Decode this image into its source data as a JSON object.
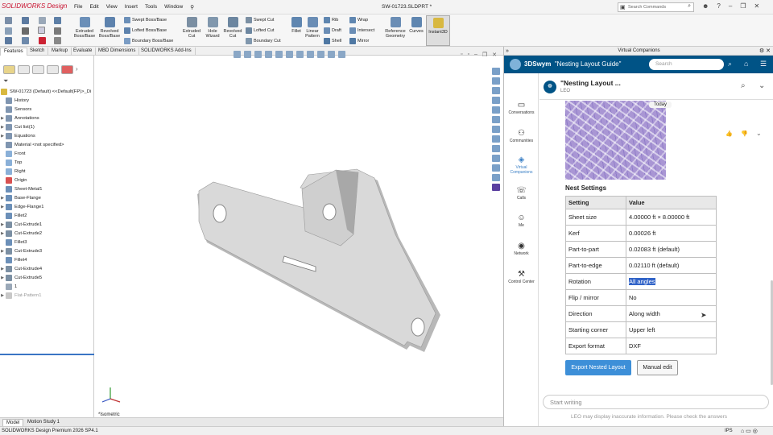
{
  "app": {
    "logo": "SOLIDWORKS Design",
    "menu": [
      "File",
      "Edit",
      "View",
      "Insert",
      "Tools",
      "Window"
    ],
    "file_title": "SW-01723.SLDPRT *",
    "search_placeholder": "Search Commands"
  },
  "ribbon": {
    "big": [
      {
        "label": "Extruded\nBoss/Base",
        "icon": "extruded-boss-icon"
      },
      {
        "label": "Revolved\nBoss/Base",
        "icon": "revolved-boss-icon"
      },
      {
        "label": "Extruded\nCut",
        "icon": "extruded-cut-icon"
      },
      {
        "label": "Hole\nWizard",
        "icon": "hole-wizard-icon"
      },
      {
        "label": "Revolved\nCut",
        "icon": "revolved-cut-icon"
      },
      {
        "label": "Fillet",
        "icon": "fillet-icon"
      },
      {
        "label": "Linear\nPattern",
        "icon": "linear-pattern-icon"
      },
      {
        "label": "Reference\nGeometry",
        "icon": "reference-geometry-icon"
      },
      {
        "label": "Curves",
        "icon": "curves-icon"
      },
      {
        "label": "Instant3D",
        "icon": "instant3d-icon"
      }
    ],
    "small": [
      "Swept Boss/Base",
      "Lofted Boss/Base",
      "Boundary Boss/Base",
      "Swept Cut",
      "Lofted Cut",
      "Boundary Cut",
      "Rib",
      "Draft",
      "Shell",
      "Wrap",
      "Intersect",
      "Mirror"
    ]
  },
  "cm_tabs": [
    "Features",
    "Sketch",
    "Markup",
    "Evaluate",
    "MBD Dimensions",
    "SOLIDWORKS Add-Ins"
  ],
  "tree": [
    {
      "label": "SW-01723 (Default) <<Default(FP)>_Di",
      "arrow": false,
      "indent": 0
    },
    {
      "label": "History",
      "arrow": false,
      "indent": 1
    },
    {
      "label": "Sensors",
      "arrow": false,
      "indent": 1
    },
    {
      "label": "Annotations",
      "arrow": true,
      "indent": 1
    },
    {
      "label": "Cut list(1)",
      "arrow": true,
      "indent": 1
    },
    {
      "label": "Equations",
      "arrow": true,
      "indent": 1
    },
    {
      "label": "Material <not specified>",
      "arrow": false,
      "indent": 1
    },
    {
      "label": "Front",
      "arrow": false,
      "indent": 1
    },
    {
      "label": "Top",
      "arrow": false,
      "indent": 1
    },
    {
      "label": "Right",
      "arrow": false,
      "indent": 1
    },
    {
      "label": "Origin",
      "arrow": false,
      "indent": 1
    },
    {
      "label": "Sheet-Metal1",
      "arrow": false,
      "indent": 1
    },
    {
      "label": "Base-Flange",
      "arrow": true,
      "indent": 1
    },
    {
      "label": "Edge-Flange1",
      "arrow": true,
      "indent": 1
    },
    {
      "label": "Fillet2",
      "arrow": false,
      "indent": 1
    },
    {
      "label": "Cut-Extrude1",
      "arrow": true,
      "indent": 1
    },
    {
      "label": "Cut-Extrude2",
      "arrow": true,
      "indent": 1
    },
    {
      "label": "Fillet3",
      "arrow": false,
      "indent": 1
    },
    {
      "label": "Cut-Extrude3",
      "arrow": true,
      "indent": 1
    },
    {
      "label": "Fillet4",
      "arrow": false,
      "indent": 1
    },
    {
      "label": "Cut-Extrude4",
      "arrow": true,
      "indent": 1
    },
    {
      "label": "Cut-Extrude5",
      "arrow": true,
      "indent": 1
    },
    {
      "label": "1",
      "arrow": false,
      "indent": 1
    },
    {
      "label": "Flat-Pattern1",
      "arrow": true,
      "indent": 1
    }
  ],
  "viewport": {
    "view_label": "*Isometric"
  },
  "bottom_tabs": [
    "Model",
    "Motion Study 1"
  ],
  "status": {
    "left": "SOLIDWORKS Design Premium 2026 SP4.1",
    "units": "IPS"
  },
  "vc": {
    "window_title": "Virtual Companions",
    "brand": "3DSwym",
    "conversation": "\"Nesting Layout Guide\"",
    "search_placeholder": "Search",
    "nav": [
      {
        "label": "Conversations",
        "icon": "conversations-icon"
      },
      {
        "label": "Communities",
        "icon": "communities-icon"
      },
      {
        "label": "Virtual\nCompanions",
        "icon": "virtual-companions-icon"
      },
      {
        "label": "Calls",
        "icon": "calls-icon"
      },
      {
        "label": "Me",
        "icon": "me-icon"
      },
      {
        "label": "Network",
        "icon": "network-icon"
      },
      {
        "label": "Control Center",
        "icon": "control-center-icon"
      }
    ],
    "chat_title": "\"Nesting Layout ...",
    "chat_sub": "LEO",
    "today": "Today",
    "nest_heading": "Nest Settings",
    "table_headers": [
      "Setting",
      "Value"
    ],
    "table_rows": [
      [
        "Sheet size",
        "4.00000 ft × 8.00000 ft"
      ],
      [
        "Kerf",
        "0.00026 ft"
      ],
      [
        "Part-to-part",
        "0.02083 ft (default)"
      ],
      [
        "Part-to-edge",
        "0.02110 ft (default)"
      ],
      [
        "Rotation",
        "All angles"
      ],
      [
        "Flip / mirror",
        "No"
      ],
      [
        "Direction",
        "Along width"
      ],
      [
        "Starting corner",
        "Upper left"
      ],
      [
        "Export format",
        "DXF"
      ]
    ],
    "export_btn": "Export Nested Layout",
    "manual_btn": "Manual edit",
    "write_placeholder": "Start writing",
    "disclaimer": "LEO may display inaccurate information. Please check the answers"
  }
}
